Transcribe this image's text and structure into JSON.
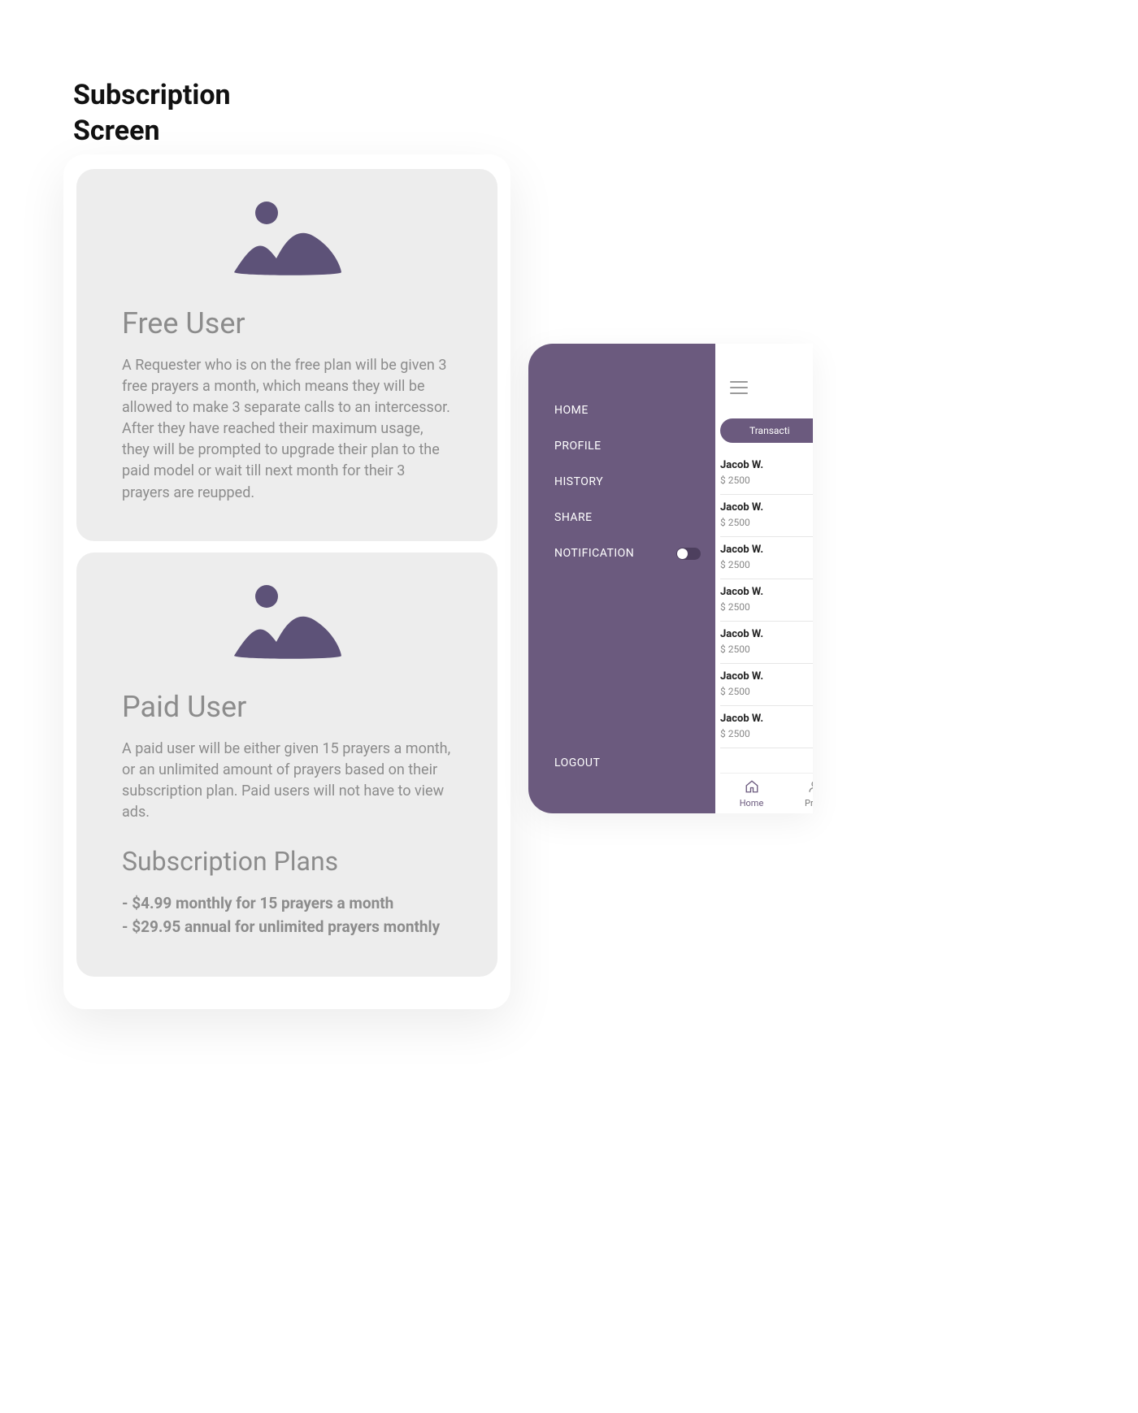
{
  "page": {
    "title_line1": "Subscription",
    "title_line2": "Screen"
  },
  "plans": {
    "free": {
      "heading": "Free User",
      "body": "A Requester who is on the free plan will be given 3 free prayers a month, which means they will be allowed to make 3 separate calls to an intercessor. After they have reached their maximum usage, they will be prompted to upgrade their plan to the paid model or wait till next month for their 3 prayers are reupped."
    },
    "paid": {
      "heading": "Paid User",
      "body": "A paid user will be either given 15 prayers a month, or an unlimited amount of prayers based on their subscription plan. Paid users will not have to view ads.",
      "plans_heading": "Subscription Plans",
      "bullets": [
        "- $4.99 monthly for 15 prayers a month",
        "- $29.95 annual for unlimited prayers monthly"
      ]
    }
  },
  "drawer": {
    "items": [
      {
        "label": "HOME"
      },
      {
        "label": "PROFILE"
      },
      {
        "label": "HISTORY"
      },
      {
        "label": "SHARE"
      },
      {
        "label": "NOTIFICATION"
      }
    ],
    "logout": "LOGOUT"
  },
  "content": {
    "tab_label": "Transacti",
    "rows": [
      {
        "name": "Jacob W.",
        "amount": "$ 2500"
      },
      {
        "name": "Jacob W.",
        "amount": "$ 2500"
      },
      {
        "name": "Jacob W.",
        "amount": "$ 2500"
      },
      {
        "name": "Jacob W.",
        "amount": "$ 2500"
      },
      {
        "name": "Jacob W.",
        "amount": "$ 2500"
      },
      {
        "name": "Jacob W.",
        "amount": "$ 2500"
      },
      {
        "name": "Jacob W.",
        "amount": "$ 2500"
      }
    ]
  },
  "bottom_nav": {
    "home": "Home",
    "profile": "Profi"
  },
  "colors": {
    "brand_purple": "#6b5a7e",
    "card_gray": "#ededed",
    "text_muted": "#8c8c8c"
  }
}
